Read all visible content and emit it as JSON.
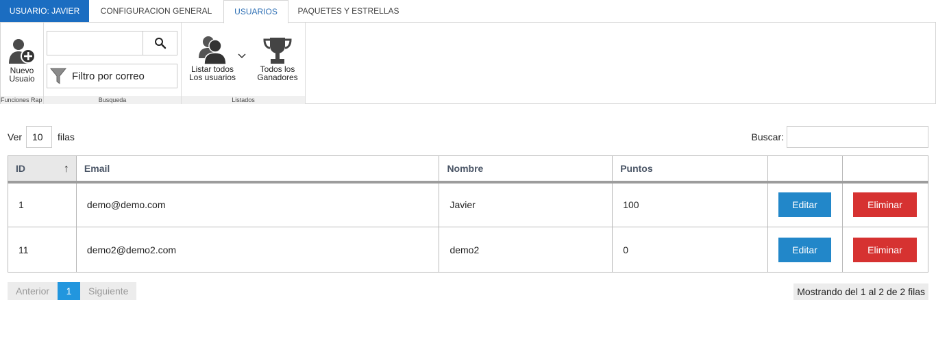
{
  "tabs": {
    "user": "USUARIO: JAVIER",
    "config": "CONFIGURACION GENERAL",
    "usuarios": "USUARIOS",
    "paquetes": "PAQUETES Y ESTRELLAS"
  },
  "ribbon": {
    "nuevo_line1": "Nuevo",
    "nuevo_line2": "Usuaio",
    "group1_label": "Funciones Rap",
    "search_value": "",
    "filter_label": "Filtro por correo",
    "group2_label": "Busqueda",
    "listar_line1": "Listar todos",
    "listar_line2": "Los usuarios",
    "ganadores_line1": "Todos los",
    "ganadores_line2": "Ganadores",
    "group3_label": "Listados"
  },
  "table_controls": {
    "ver": "Ver",
    "length": "10",
    "filas": "filas",
    "buscar": "Buscar:",
    "search_value": ""
  },
  "table": {
    "columns": [
      "ID",
      "Email",
      "Nombre",
      "Puntos",
      "",
      ""
    ],
    "rows": [
      {
        "id": "1",
        "email": "demo@demo.com",
        "nombre": "Javier",
        "puntos": "100",
        "edit": "Editar",
        "delete": "Eliminar"
      },
      {
        "id": "11",
        "email": "demo2@demo2.com",
        "nombre": "demo2",
        "puntos": "0",
        "edit": "Editar",
        "delete": "Eliminar"
      }
    ]
  },
  "pager": {
    "prev": "Anterior",
    "current": "1",
    "next": "Siguiente"
  },
  "info": "Mostrando del 1 al 2 de 2 filas",
  "colors": {
    "tab_active_bg": "#1b6dc1",
    "edit_button": "#2287c9",
    "delete_button": "#d63231",
    "page_active": "#2296de"
  },
  "icons": [
    "add-user-icon",
    "search-icon",
    "filter-icon",
    "users-group-icon",
    "chevron-down-icon",
    "trophy-icon",
    "sort-ascending-icon"
  ]
}
